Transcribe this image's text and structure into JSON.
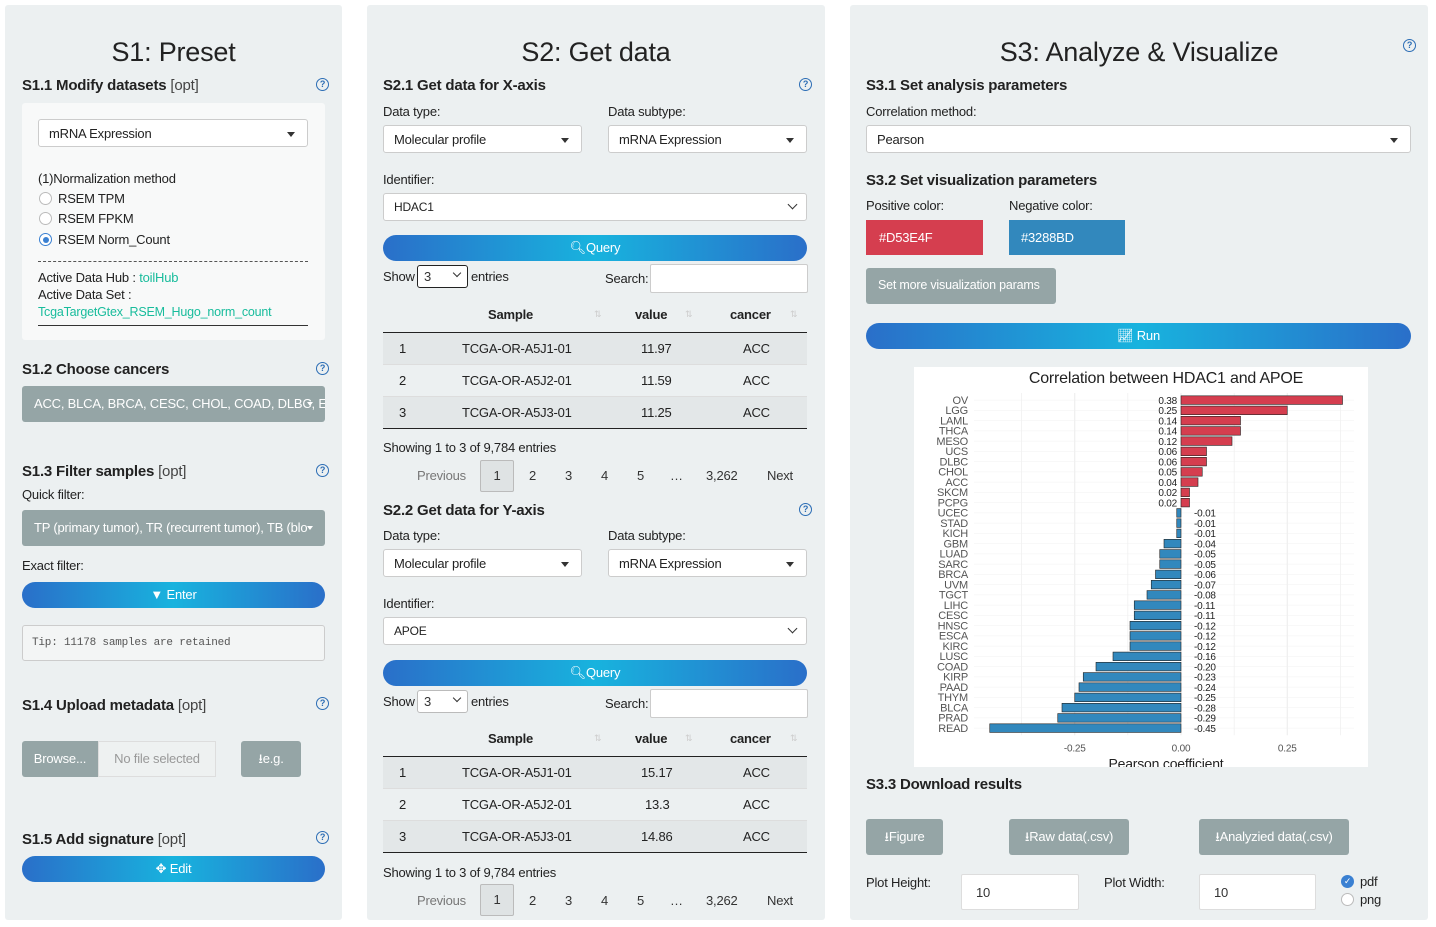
{
  "s1": {
    "title": "S1: Preset",
    "s11": {
      "title": "S1.1 Modify datasets",
      "opt": "[opt]",
      "dataset": "mRNA Expression",
      "norm_label": "(1)Normalization method",
      "radios": [
        "RSEM TPM",
        "RSEM FPKM",
        "RSEM Norm_Count"
      ],
      "selected_radio": 2,
      "hub_label": "Active Data Hub :",
      "hub_value": "toilHub",
      "set_label": "Active Data Set :",
      "set_value": "TcgaTargetGtex_RSEM_Hugo_norm_count"
    },
    "s12": {
      "title": "S1.2 Choose cancers",
      "value": "ACC, BLCA, BRCA, CESC, CHOL, COAD, DLBC, E"
    },
    "s13": {
      "title": "S1.3 Filter samples",
      "opt": "[opt]",
      "quick_label": "Quick filter:",
      "quick_value": "TP (primary tumor), TR (recurrent tumor), TB (blo",
      "exact_label": "Exact filter:",
      "enter": "Enter",
      "tip": "Tip: 11178 samples are retained"
    },
    "s14": {
      "title": "S1.4 Upload metadata",
      "opt": "[opt]",
      "browse": "Browse...",
      "nofile": "No file selected",
      "eg": "e.g."
    },
    "s15": {
      "title": "S1.5 Add signature",
      "opt": "[opt]",
      "edit": "Edit"
    }
  },
  "s2": {
    "title": "S2: Get data",
    "x": {
      "title": "S2.1 Get data for X-axis",
      "type_label": "Data type:",
      "type": "Molecular profile",
      "subtype_label": "Data subtype:",
      "subtype": "mRNA Expression",
      "id_label": "Identifier:",
      "id": "HDAC1",
      "query": "Query",
      "show": "Show",
      "entries_sel": "3",
      "entries": "entries",
      "search": "Search:",
      "cols": [
        "Sample",
        "value",
        "cancer"
      ],
      "rows": [
        [
          "1",
          "TCGA-OR-A5J1-01",
          "11.97",
          "ACC"
        ],
        [
          "2",
          "TCGA-OR-A5J2-01",
          "11.59",
          "ACC"
        ],
        [
          "3",
          "TCGA-OR-A5J3-01",
          "11.25",
          "ACC"
        ]
      ],
      "info": "Showing 1 to 3 of 9,784 entries",
      "pages": [
        "Previous",
        "1",
        "2",
        "3",
        "4",
        "5",
        "…",
        "3,262",
        "Next"
      ]
    },
    "y": {
      "title": "S2.2 Get data for Y-axis",
      "type_label": "Data type:",
      "type": "Molecular profile",
      "subtype_label": "Data subtype:",
      "subtype": "mRNA Expression",
      "id_label": "Identifier:",
      "id": "APOE",
      "query": "Query",
      "show": "Show",
      "entries_sel": "3",
      "entries": "entries",
      "search": "Search:",
      "cols": [
        "Sample",
        "value",
        "cancer"
      ],
      "rows": [
        [
          "1",
          "TCGA-OR-A5J1-01",
          "15.17",
          "ACC"
        ],
        [
          "2",
          "TCGA-OR-A5J2-01",
          "13.3",
          "ACC"
        ],
        [
          "3",
          "TCGA-OR-A5J3-01",
          "14.86",
          "ACC"
        ]
      ],
      "info": "Showing 1 to 3 of 9,784 entries",
      "pages": [
        "Previous",
        "1",
        "2",
        "3",
        "4",
        "5",
        "…",
        "3,262",
        "Next"
      ]
    }
  },
  "s3": {
    "title": "S3: Analyze & Visualize",
    "s31": {
      "title": "S3.1 Set analysis parameters",
      "method_label": "Correlation method:",
      "method": "Pearson"
    },
    "s32": {
      "title": "S3.2 Set visualization parameters",
      "pos_label": "Positive color:",
      "pos": "#D53E4F",
      "neg_label": "Negative color:",
      "neg": "#3288BD",
      "more": "Set more visualization params"
    },
    "run": "Run",
    "s33": {
      "title": "S3.3 Download results",
      "figure": "Figure",
      "raw": "Raw data(.csv)",
      "analyzed": "Analyzied data(.csv)",
      "height_label": "Plot Height:",
      "height": "10",
      "width_label": "Plot Width:",
      "width": "10",
      "formats": [
        "pdf",
        "png"
      ]
    }
  },
  "chart_data": {
    "type": "bar",
    "title": "Correlation between HDAC1 and APOE",
    "xlabel": "Pearson coefficient",
    "ylabel": "",
    "xlim": [
      -0.45,
      0.38
    ],
    "xticks": [
      "-0.25",
      "0.00",
      "0.25"
    ],
    "grid": true,
    "pos_color": "#D53E4F",
    "neg_color": "#3288BD",
    "categories": [
      "OV",
      "LGG",
      "LAML",
      "THCA",
      "MESO",
      "UCS",
      "DLBC",
      "CHOL",
      "ACC",
      "SKCM",
      "PCPG",
      "UCEC",
      "STAD",
      "KICH",
      "GBM",
      "LUAD",
      "SARC",
      "BRCA",
      "UVM",
      "TGCT",
      "LIHC",
      "CESC",
      "HNSC",
      "ESCA",
      "KIRC",
      "LUSC",
      "COAD",
      "KIRP",
      "PAAD",
      "THYM",
      "BLCA",
      "PRAD",
      "READ"
    ],
    "values": [
      0.38,
      0.25,
      0.14,
      0.14,
      0.12,
      0.06,
      0.06,
      0.05,
      0.04,
      0.02,
      0.02,
      -0.01,
      -0.01,
      -0.01,
      -0.04,
      -0.05,
      -0.05,
      -0.06,
      -0.07,
      -0.08,
      -0.11,
      -0.11,
      -0.12,
      -0.12,
      -0.12,
      -0.16,
      -0.2,
      -0.23,
      -0.24,
      -0.25,
      -0.28,
      -0.29,
      -0.45
    ],
    "labels": [
      "0.38",
      "0.25",
      "0.14",
      "0.14",
      "0.12",
      "0.06",
      "0.06",
      "0.05",
      "0.04",
      "0.02",
      "0.02",
      "-0.01",
      "-0.01",
      "-0.01",
      "-0.04",
      "-0.05",
      "-0.05",
      "-0.06",
      "-0.07",
      "-0.08",
      "-0.11",
      "-0.11",
      "-0.12",
      "-0.12",
      "-0.12",
      "-0.16",
      "-0.20",
      "-0.23",
      "-0.24",
      "-0.25",
      "-0.28",
      "-0.29",
      "-0.45"
    ]
  }
}
